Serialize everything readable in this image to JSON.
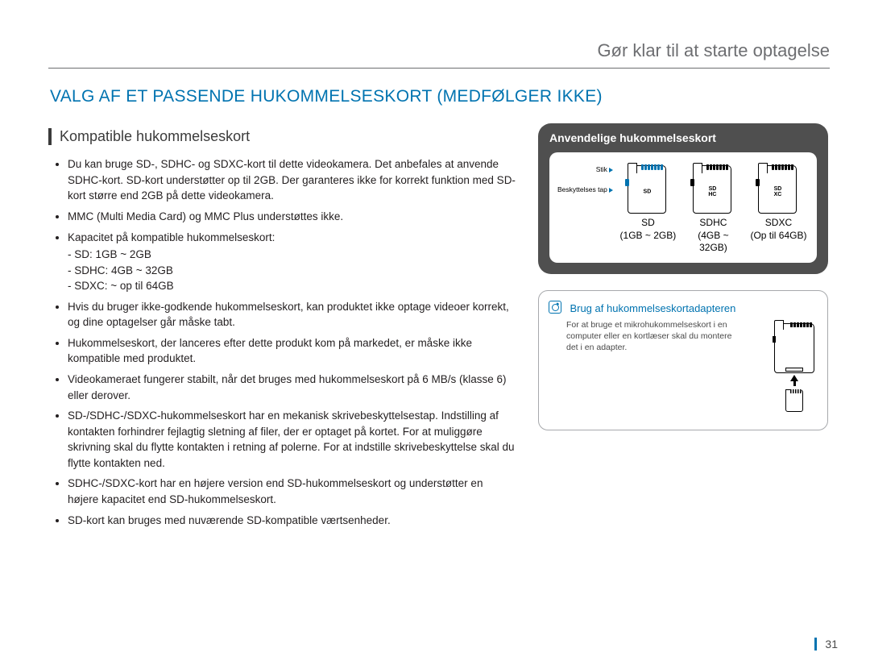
{
  "runningHead": "Gør klar til at starte optagelse",
  "sectionTitle": "VALG AF ET PASSENDE HUKOMMELSESKORT (MEDFØLGER IKKE)",
  "subhead": "Kompatible hukommelseskort",
  "bullets": {
    "b0": "Du kan bruge SD-, SDHC- og SDXC-kort til dette videokamera. Det anbefales at anvende SDHC-kort. SD-kort understøtter op til 2GB. Der garanteres ikke for korrekt funktion med SD-kort større end 2GB på dette videokamera.",
    "b1": "MMC (Multi Media Card) og MMC Plus understøttes ikke.",
    "b2": "Kapacitet på kompatible hukommelseskort:",
    "b2_sub": {
      "s0": "SD: 1GB ~ 2GB",
      "s1": "SDHC: 4GB ~ 32GB",
      "s2": "SDXC: ~ op til 64GB"
    },
    "b3": "Hvis du bruger ikke-godkende hukommelseskort, kan produktet ikke optage videoer korrekt, og dine optagelser går måske tabt.",
    "b4": "Hukommelseskort, der lanceres efter dette produkt kom på markedet, er måske ikke kompatible med produktet.",
    "b5": "Videokameraet fungerer stabilt, når det bruges med hukommelseskort på 6 MB/s (klasse 6) eller derover.",
    "b6": "SD-/SDHC-/SDXC-hukommelseskort har en mekanisk skrivebeskyttelsestap. Indstilling af kontakten forhindrer fejlagtig sletning af filer, der er optaget på kortet. For at muliggøre skrivning skal du flytte kontakten i retning af polerne. For at indstille skrivebeskyttelse skal du flytte kontakten ned.",
    "b7": "SDHC-/SDXC-kort har en højere version end SD-hukommelseskort og understøtter en højere kapacitet end SD-hukommelseskort.",
    "b8": "SD-kort kan bruges med nuværende SD-kompatible værtsenheder."
  },
  "cardBox": {
    "title": "Anvendelige hukommelseskort",
    "labelPins": "Stik",
    "labelLock": "Beskyttelses tap",
    "cards": {
      "c0": {
        "name": "SD",
        "range": "(1GB ~ 2GB)",
        "logo": "SD"
      },
      "c1": {
        "name": "SDHC",
        "range": "(4GB ~ 32GB)",
        "logo": "SD\nHC"
      },
      "c2": {
        "name": "SDXC",
        "range": "(Op til 64GB)",
        "logo": "SD\nXC"
      }
    }
  },
  "hint": {
    "title": "Brug af hukommelseskortadapteren",
    "text": "For at bruge et mikrohukommelseskort i en computer eller en kortlæser skal du montere det i en adapter."
  },
  "pageNumber": "31"
}
